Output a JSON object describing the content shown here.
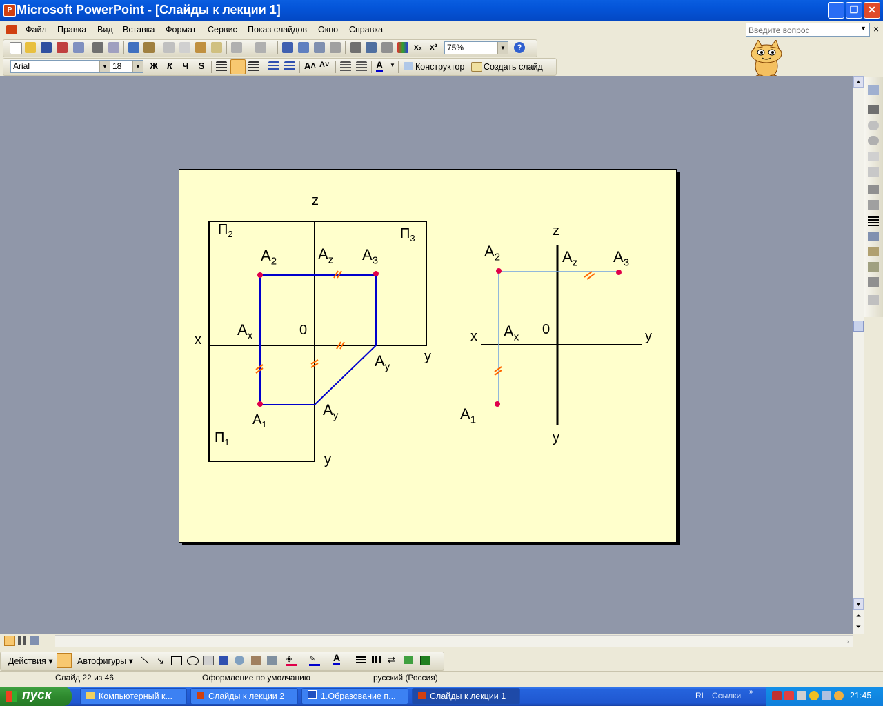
{
  "window": {
    "title": "Microsoft PowerPoint - [Слайды к лекции 1]",
    "app_icon_glyph": "P"
  },
  "menu": {
    "items": [
      "Файл",
      "Правка",
      "Вид",
      "Вставка",
      "Формат",
      "Сервис",
      "Показ слайдов",
      "Окно",
      "Справка"
    ],
    "help_placeholder": "Введите вопрос",
    "close_doc": "×"
  },
  "standard_toolbar": {
    "zoom": "75%"
  },
  "formatting_toolbar": {
    "font": "Arial",
    "size": "18",
    "bold": "Ж",
    "italic": "К",
    "underline": "Ч",
    "shadow": "S",
    "designer": "Конструктор",
    "new_slide": "Создать слайд"
  },
  "slide": {
    "left": {
      "z": "z",
      "x": "x",
      "o": "0",
      "y_right": "y",
      "y_bottom": "y",
      "p2": "П",
      "p2_sub": "2",
      "p3": "П",
      "p3_sub": "3",
      "p1": "П",
      "p1_sub": "1",
      "a2": "A",
      "a2_sub": "2",
      "az": "A",
      "az_sub": "z",
      "a3": "A",
      "a3_sub": "3",
      "ax": "A",
      "ax_sub": "x",
      "ay1": "A",
      "ay1_sub": "y",
      "a1": "A",
      "a1_sub": "1",
      "ay2": "A",
      "ay2_sub": "y"
    },
    "right": {
      "z": "z",
      "x": "x",
      "y_right": "y",
      "y_bottom": "y",
      "o": "0",
      "a2": "A",
      "a2_sub": "2",
      "az": "A",
      "az_sub": "z",
      "a3": "A",
      "a3_sub": "3",
      "ax": "A",
      "ax_sub": "x",
      "a1": "A",
      "a1_sub": "1"
    },
    "colors": {
      "background": "#ffffcc",
      "lines": "#0000cc",
      "light_lines": "#6fa0e0",
      "points": "#e0004a",
      "ticks": "#ff6600"
    }
  },
  "drawing_toolbar": {
    "actions": "Действия",
    "autoshapes": "Автофигуры"
  },
  "status": {
    "slide": "Слайд 22 из 46",
    "design": "Оформление по умолчанию",
    "language": "русский (Россия)"
  },
  "taskbar": {
    "start": "пуск",
    "tasks": [
      "Компьютерный к...",
      "Слайды к лекции 2",
      "1.Образование п...",
      "Слайды к лекции 1"
    ],
    "lang": "RL",
    "links": "Ссылки",
    "time": "21:45"
  }
}
